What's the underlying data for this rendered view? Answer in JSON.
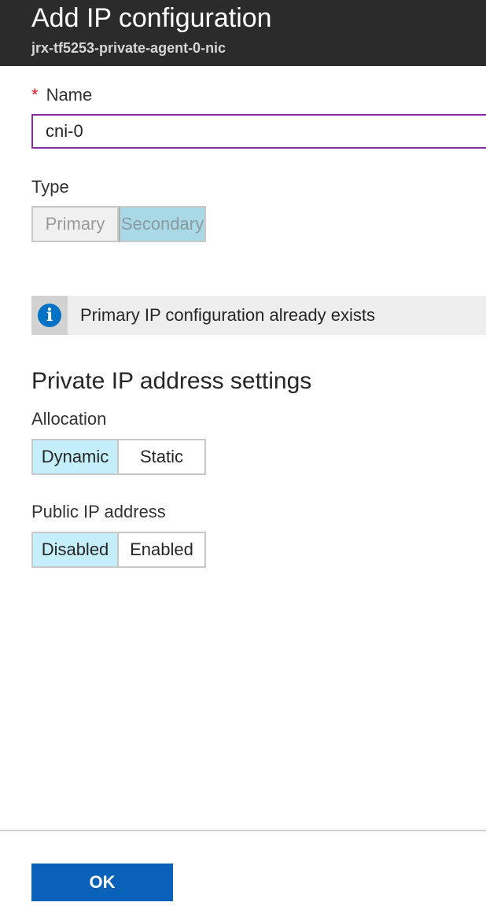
{
  "header": {
    "title": "Add IP configuration",
    "subtitle": "jrx-tf5253-private-agent-0-nic"
  },
  "name_field": {
    "required_marker": "*",
    "label": "Name",
    "value": "cni-0"
  },
  "type": {
    "label": "Type",
    "options": [
      "Primary",
      "Secondary"
    ],
    "selected": "Secondary",
    "disabled": true
  },
  "info": {
    "icon": "info-icon",
    "icon_glyph": "i",
    "message": "Primary IP configuration already exists"
  },
  "private_ip": {
    "heading": "Private IP address settings",
    "allocation": {
      "label": "Allocation",
      "options": [
        "Dynamic",
        "Static"
      ],
      "selected": "Dynamic"
    },
    "public_ip": {
      "label": "Public IP address",
      "options": [
        "Disabled",
        "Enabled"
      ],
      "selected": "Disabled"
    }
  },
  "footer": {
    "ok_label": "OK"
  },
  "colors": {
    "header_bg": "#2b2b2b",
    "input_border": "#8a2ba0",
    "selected_bg": "#c4eefa",
    "ok_bg": "#0961b8",
    "info_icon": "#0072c6",
    "required": "#e81123"
  }
}
